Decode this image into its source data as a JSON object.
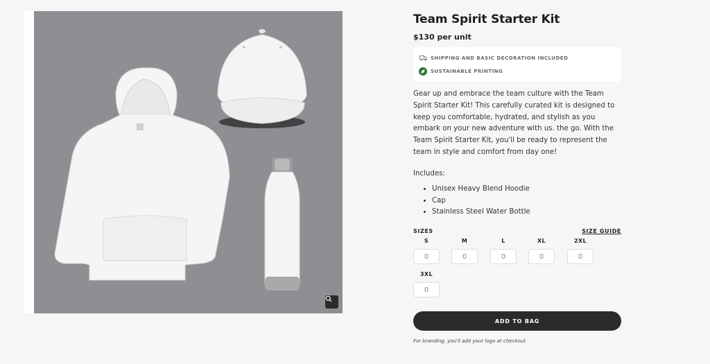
{
  "product": {
    "title": "Team Spirit Starter Kit",
    "price": "$130 per unit",
    "badges": [
      {
        "icon": "truck-icon",
        "text": "SHIPPING AND BASIC DECORATION INCLUDED"
      },
      {
        "icon": "leaf-icon",
        "text": "SUSTAINABLE PRINTING"
      }
    ],
    "description": "Gear up and embrace the team culture with the Team Spirit Starter Kit! This carefully curated kit is designed to keep you comfortable, hydrated, and stylish as you embark on your new adventure with us. the go. With the Team Spirit Starter Kit, you'll be ready to represent the team in style and comfort from day one!",
    "includes_title": "Includes:",
    "includes": [
      "Unisex Heavy Blend Hoodie",
      "Cap",
      "Stainless Steel Water Bottle"
    ]
  },
  "sizes": {
    "label": "SIZES",
    "guide_label": "SIZE GUIDE",
    "options": [
      {
        "size": "S",
        "qty": "0"
      },
      {
        "size": "M",
        "qty": "0"
      },
      {
        "size": "L",
        "qty": "0"
      },
      {
        "size": "XL",
        "qty": "0"
      },
      {
        "size": "2XL",
        "qty": "0"
      },
      {
        "size": "3XL",
        "qty": "0"
      }
    ]
  },
  "actions": {
    "add_to_bag": "ADD TO BAG",
    "branding_note": "For branding, you'll add your logo at checkout."
  },
  "gallery": {
    "zoom_icon": "magnifier-icon",
    "background_color": "#8f8f93"
  }
}
